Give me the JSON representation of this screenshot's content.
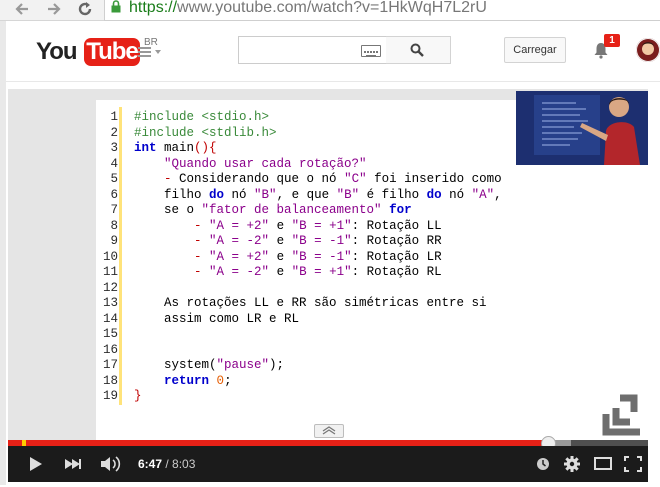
{
  "browser": {
    "url_protocol": "https://",
    "url_rest": "www.youtube.com/watch?v=1HkWqH7L2rU"
  },
  "header": {
    "logo_you": "You",
    "logo_tube": "Tube",
    "region": "BR",
    "upload_label": "Carregar",
    "notification_count": "1",
    "search_placeholder": ""
  },
  "video": {
    "current_time": "6:47",
    "separator": " / ",
    "duration": "8:03",
    "progress_fraction": 0.843,
    "buffer_fraction": 0.88
  },
  "code": {
    "line_numbers": [
      "1",
      "2",
      "3",
      "4",
      "5",
      "6",
      "7",
      "8",
      "9",
      "10",
      "11",
      "12",
      "13",
      "14",
      "15",
      "16",
      "17",
      "18",
      "19"
    ],
    "lines": [
      "#include <stdio.h>",
      "#include <stdlib.h>",
      "int main()",
      "    \"Quando usar cada rotação?\"",
      "    - Considerando que o nó \"C\" foi inserido como",
      "    filho do nó \"B\", e que \"B\" é filho do nó \"A\",",
      "    se o \"fator de balanceamento\" for",
      "        - \"A = +2\" e \"B = +1\": Rotação LL",
      "        - \"A = -2\" e \"B = -1\": Rotação RR",
      "        - \"A = +2\" e \"B = -1\": Rotação LR",
      "        - \"A = -2\" e \"B = +1\": Rotação RL",
      "",
      "    As rotações LL e RR são simétricas entre si",
      "    assim como LR e RL",
      "",
      "",
      "    system(\"pause\");",
      "    return 0;",
      "}"
    ]
  },
  "colors": {
    "brand_red": "#e62117",
    "progress_red": "#e62117",
    "keyword_blue": "#0000cc",
    "preprocessor_green": "#3a8a3a",
    "string_purple": "#8b008b"
  },
  "icons": [
    "back-arrow-icon",
    "forward-arrow-icon",
    "reload-icon",
    "lock-icon",
    "guide-menu-icon",
    "keyboard-icon",
    "search-icon",
    "bell-icon",
    "play-icon",
    "next-icon",
    "volume-icon",
    "watch-later-icon",
    "gear-icon",
    "theater-mode-icon",
    "fullscreen-icon"
  ]
}
